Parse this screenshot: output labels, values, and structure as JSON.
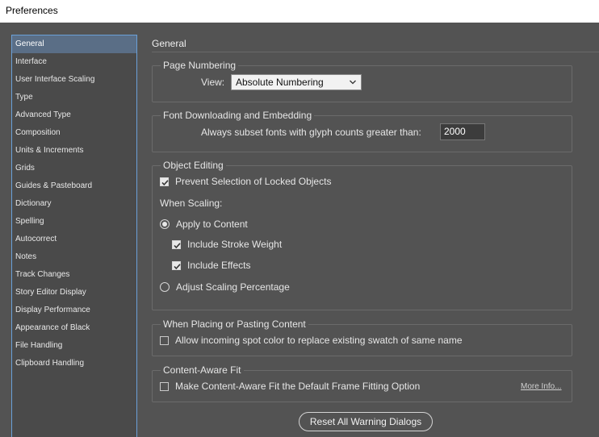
{
  "window": {
    "title": "Preferences"
  },
  "sidebar": {
    "items": [
      {
        "label": "General"
      },
      {
        "label": "Interface"
      },
      {
        "label": "User Interface Scaling"
      },
      {
        "label": "Type"
      },
      {
        "label": "Advanced Type"
      },
      {
        "label": "Composition"
      },
      {
        "label": "Units & Increments"
      },
      {
        "label": "Grids"
      },
      {
        "label": "Guides & Pasteboard"
      },
      {
        "label": "Dictionary"
      },
      {
        "label": "Spelling"
      },
      {
        "label": "Autocorrect"
      },
      {
        "label": "Notes"
      },
      {
        "label": "Track Changes"
      },
      {
        "label": "Story Editor Display"
      },
      {
        "label": "Display Performance"
      },
      {
        "label": "Appearance of Black"
      },
      {
        "label": "File Handling"
      },
      {
        "label": "Clipboard Handling"
      }
    ],
    "selected": "General"
  },
  "main": {
    "heading": "General",
    "page_numbering": {
      "title": "Page Numbering",
      "view_label": "View:",
      "view_value": "Absolute Numbering"
    },
    "font_downloading": {
      "title": "Font Downloading and Embedding",
      "subset_label": "Always subset fonts with glyph counts greater than:",
      "subset_value": "2000"
    },
    "object_editing": {
      "title": "Object Editing",
      "prevent_selection_label": "Prevent Selection of Locked Objects",
      "prevent_selection_checked": true,
      "when_scaling_label": "When Scaling:",
      "apply_to_content_label": "Apply to Content",
      "apply_to_content_selected": true,
      "include_stroke_label": "Include Stroke Weight",
      "include_stroke_checked": true,
      "include_effects_label": "Include Effects",
      "include_effects_checked": true,
      "adjust_scaling_label": "Adjust Scaling Percentage",
      "adjust_scaling_selected": false
    },
    "placing": {
      "title": "When Placing or Pasting Content",
      "spot_color_label": "Allow incoming spot color to replace existing swatch of same name",
      "spot_color_checked": false
    },
    "content_aware": {
      "title": "Content-Aware Fit",
      "default_label": "Make Content-Aware Fit the Default Frame Fitting Option",
      "default_checked": false,
      "more_info": "More Info..."
    },
    "reset_button": "Reset All Warning Dialogs"
  },
  "icons": {
    "checkmark": "checkmark-icon",
    "dropdown": "chevron-down-icon"
  },
  "colors": {
    "background": "#535353",
    "sidebar_selected": "#5a6e86",
    "sidebar_border": "#6aa0d8"
  }
}
